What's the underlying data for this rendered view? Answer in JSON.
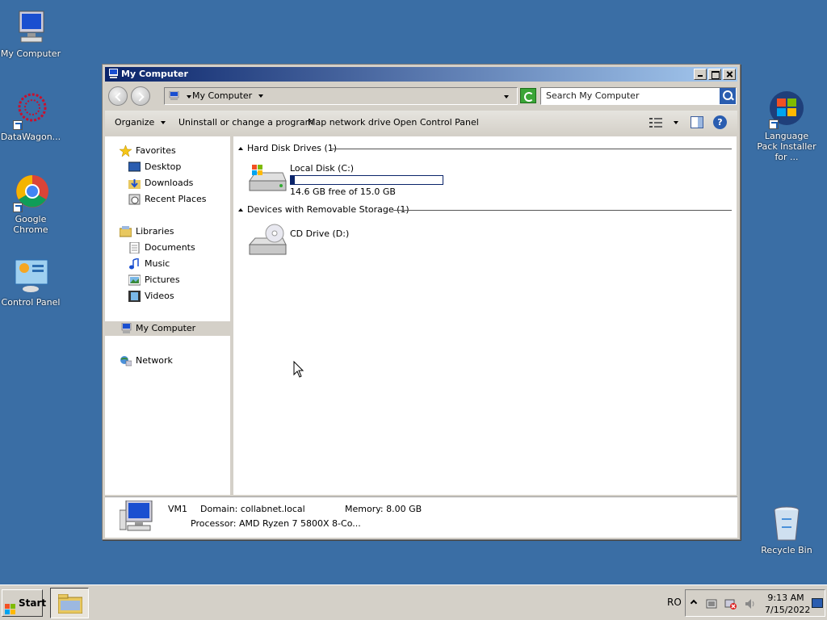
{
  "desktop": {
    "icons": [
      {
        "label": "My Computer"
      },
      {
        "label": "DataWagon..."
      },
      {
        "label": "Google Chrome"
      },
      {
        "label": "Control Panel"
      },
      {
        "label": "Language Pack Installer for ..."
      },
      {
        "label": "Recycle Bin"
      }
    ]
  },
  "window": {
    "title": "My Computer",
    "address": {
      "location": "My Computer"
    },
    "search": {
      "placeholder": "Search My Computer"
    },
    "toolbar": {
      "organize": "Organize",
      "uninstall": "Uninstall or change a program",
      "map_drive": "Map network drive",
      "control_panel": "Open Control Panel",
      "help": "?"
    },
    "nav": {
      "favorites": "Favorites",
      "desktop": "Desktop",
      "downloads": "Downloads",
      "recent": "Recent Places",
      "libraries": "Libraries",
      "documents": "Documents",
      "music": "Music",
      "pictures": "Pictures",
      "videos": "Videos",
      "my_computer": "My Computer",
      "network": "Network"
    },
    "groups": {
      "hdd": {
        "header": "Hard Disk Drives (1)",
        "drive_name": "Local Disk (C:)",
        "drive_free": "14.6 GB free of 15.0 GB",
        "used_fraction": 0.027
      },
      "removable": {
        "header": "Devices with Removable Storage (1)",
        "drive_name": "CD Drive (D:)"
      }
    },
    "details": {
      "name": "VM1",
      "domain": "Domain: collabnet.local",
      "memory": "Memory: 8.00 GB",
      "processor": "Processor: AMD Ryzen 7 5800X 8-Co..."
    }
  },
  "taskbar": {
    "start": "Start",
    "language": "RO",
    "time": "9:13 AM",
    "date": "7/15/2022"
  },
  "colors": {
    "desktop": "#3a6ea5",
    "title_gradient_start": "#0a246a",
    "title_gradient_end": "#a6caf0",
    "drive_fill": "#0a246a"
  }
}
